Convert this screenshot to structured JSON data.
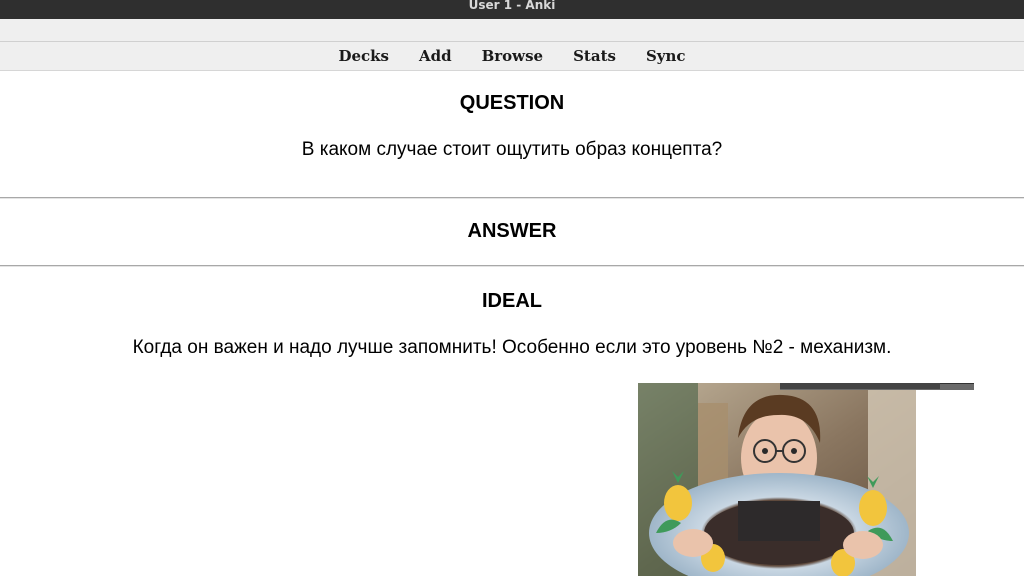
{
  "window": {
    "title": "User 1 - Anki"
  },
  "toolbar": {
    "items": [
      "Decks",
      "Add",
      "Browse",
      "Stats",
      "Sync"
    ]
  },
  "card": {
    "question_heading": "QUESTION",
    "question_text": "В каком случае стоит ощутить образ концепта?",
    "answer_heading": "ANSWER",
    "ideal_heading": "IDEAL",
    "ideal_text": "Когда он важен и надо лучше запомнить! Особенно если это уровень №2 - механизм."
  },
  "colors": {
    "titlebar": "#2f2f2f",
    "toolbar": "#efefef",
    "background": "#ffffff"
  }
}
